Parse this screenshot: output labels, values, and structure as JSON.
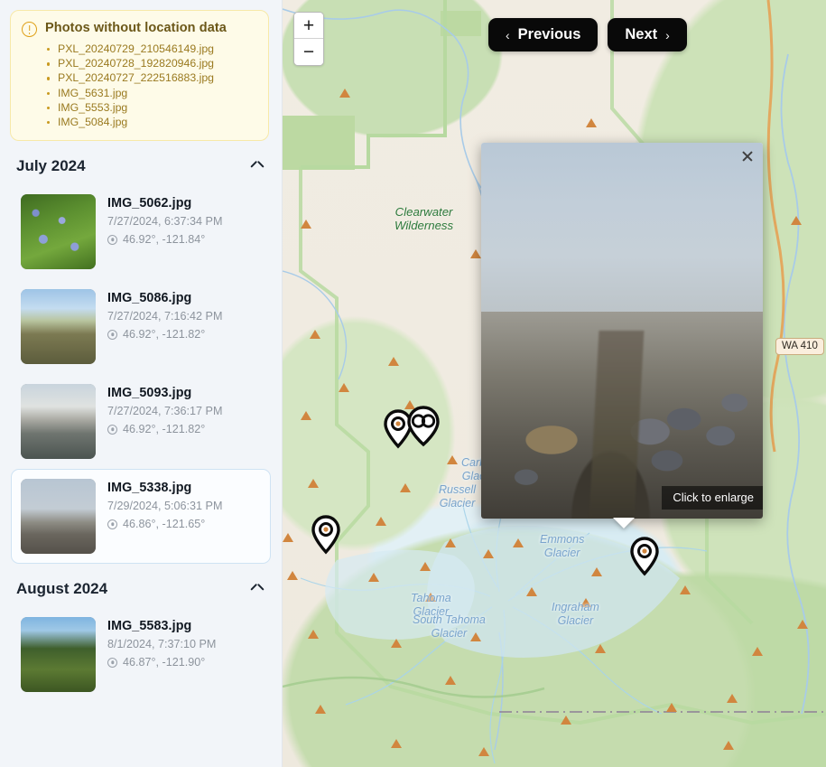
{
  "warning": {
    "title": "Photos without location data",
    "icon": "alert-circle-icon",
    "files": [
      "PXL_20240729_210546149.jpg",
      "PXL_20240728_192820946.jpg",
      "PXL_20240727_222516883.jpg",
      "IMG_5631.jpg",
      "IMG_5553.jpg",
      "IMG_5084.jpg"
    ]
  },
  "groups": [
    {
      "title": "July 2024",
      "collapse_icon": "chevron-up-icon",
      "photos": [
        {
          "name": "IMG_5062.jpg",
          "date": "7/27/2024, 6:37:34 PM",
          "coords": "46.92°, -121.84°",
          "thumb_class": "th-5062",
          "selected": false
        },
        {
          "name": "IMG_5086.jpg",
          "date": "7/27/2024, 7:16:42 PM",
          "coords": "46.92°, -121.82°",
          "thumb_class": "th-5086",
          "selected": false
        },
        {
          "name": "IMG_5093.jpg",
          "date": "7/27/2024, 7:36:17 PM",
          "coords": "46.92°, -121.82°",
          "thumb_class": "th-5093",
          "selected": false
        },
        {
          "name": "IMG_5338.jpg",
          "date": "7/29/2024, 5:06:31 PM",
          "coords": "46.86°, -121.65°",
          "thumb_class": "th-5338",
          "selected": true
        }
      ]
    },
    {
      "title": "August 2024",
      "collapse_icon": "chevron-up-icon",
      "photos": [
        {
          "name": "IMG_5583.jpg",
          "date": "8/1/2024, 7:37:10 PM",
          "coords": "46.87°, -121.90°",
          "thumb_class": "th-5583",
          "selected": false
        }
      ]
    }
  ],
  "map": {
    "zoom_in_label": "+",
    "zoom_out_label": "−",
    "prev_label": "Previous",
    "prev_arrow": "‹",
    "next_label": "Next",
    "next_arrow": "›",
    "highway_shield": "WA 410",
    "labels": [
      {
        "text": "Clearwater\nWilderness",
        "kind": "wilderness"
      },
      {
        "text": "Carbon\nGlacier",
        "kind": "glacier"
      },
      {
        "text": "Russell\nGlacier",
        "kind": "glacier"
      },
      {
        "text": "Emmons\nGlacier",
        "kind": "glacier"
      },
      {
        "text": "Tahoma\nGlacier",
        "kind": "glacier"
      },
      {
        "text": "South Tahoma\nGlacier",
        "kind": "glacier"
      },
      {
        "text": "Ingraham\nGlacier",
        "kind": "glacier"
      }
    ],
    "markers": [
      {
        "id": "marker-cluster-left",
        "type": "single-pin"
      },
      {
        "id": "marker-cluster-group",
        "type": "cluster-pin"
      },
      {
        "id": "marker-west",
        "type": "single-pin"
      },
      {
        "id": "marker-east",
        "type": "single-pin"
      }
    ],
    "colors": {
      "land": "#f1ece2",
      "forest": "#c7dfb2",
      "glacier": "#d8ecf3",
      "water": "#9cc4e4",
      "campsite": "#d1863f",
      "highway": "#e0a458"
    }
  },
  "popup": {
    "close_icon": "close-icon",
    "caption": "Click to enlarge",
    "photo_of": "IMG_5338.jpg"
  }
}
